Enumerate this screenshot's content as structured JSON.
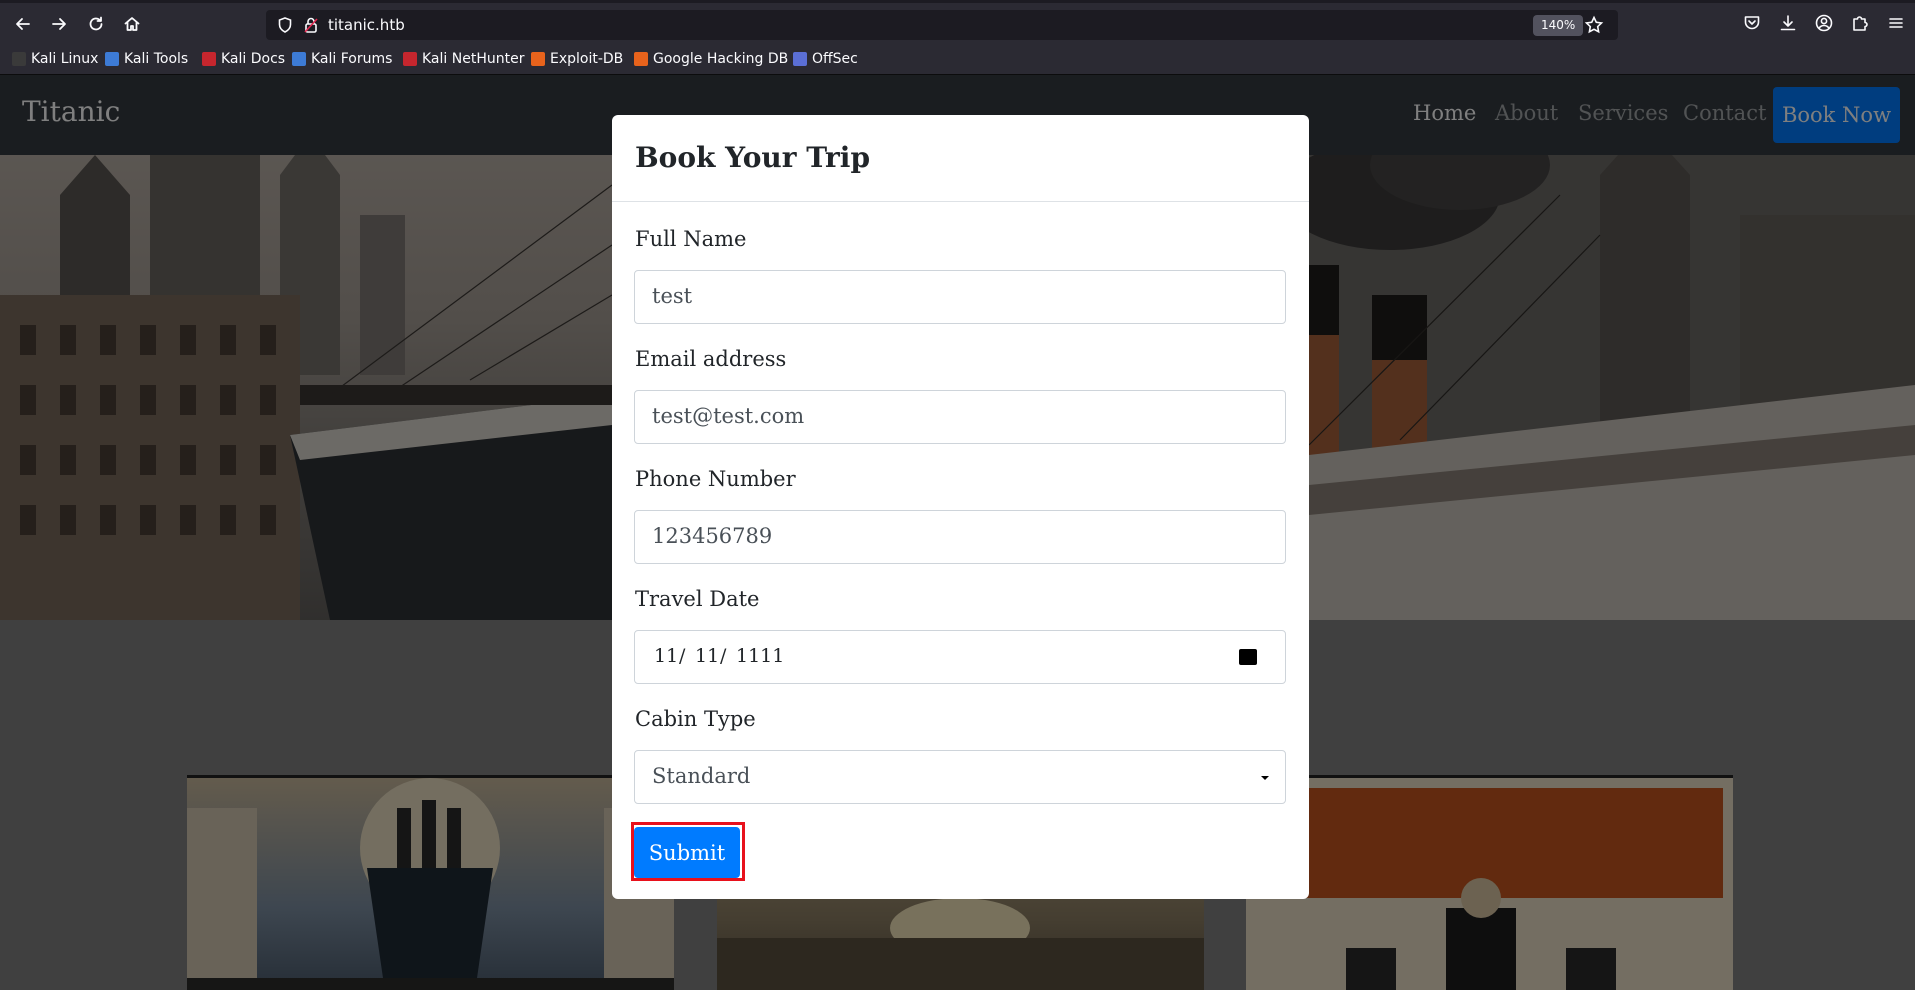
{
  "browser": {
    "url": "titanic.htb",
    "zoom": "140%",
    "bookmarks": [
      {
        "label": "Kali Linux",
        "color": "#3a3a3a"
      },
      {
        "label": "Kali Tools",
        "color": "#3d7bd6"
      },
      {
        "label": "Kali Docs",
        "color": "#c6262e"
      },
      {
        "label": "Kali Forums",
        "color": "#3d7bd6"
      },
      {
        "label": "Kali NetHunter",
        "color": "#c6262e"
      },
      {
        "label": "Exploit-DB",
        "color": "#e8631c"
      },
      {
        "label": "Google Hacking DB",
        "color": "#e8631c"
      },
      {
        "label": "OffSec",
        "color": "#5b6fd6"
      }
    ]
  },
  "site": {
    "brand": "Titanic",
    "nav": [
      "Home",
      "About",
      "Services",
      "Contact"
    ],
    "book_now": "Book Now"
  },
  "modal": {
    "title": "Book Your Trip",
    "fields": {
      "full_name": {
        "label": "Full Name",
        "value": "test"
      },
      "email": {
        "label": "Email address",
        "value": "test@test.com"
      },
      "phone": {
        "label": "Phone Number",
        "value": "123456789"
      },
      "travel_date": {
        "label": "Travel Date",
        "month": "11",
        "day": "11",
        "year": "1111",
        "separator": "/"
      },
      "cabin_type": {
        "label": "Cabin Type",
        "value": "Standard"
      }
    },
    "submit": "Submit"
  },
  "colors": {
    "primary": "#007bff",
    "highlight": "#e8111c",
    "navbar": "#343a40"
  }
}
